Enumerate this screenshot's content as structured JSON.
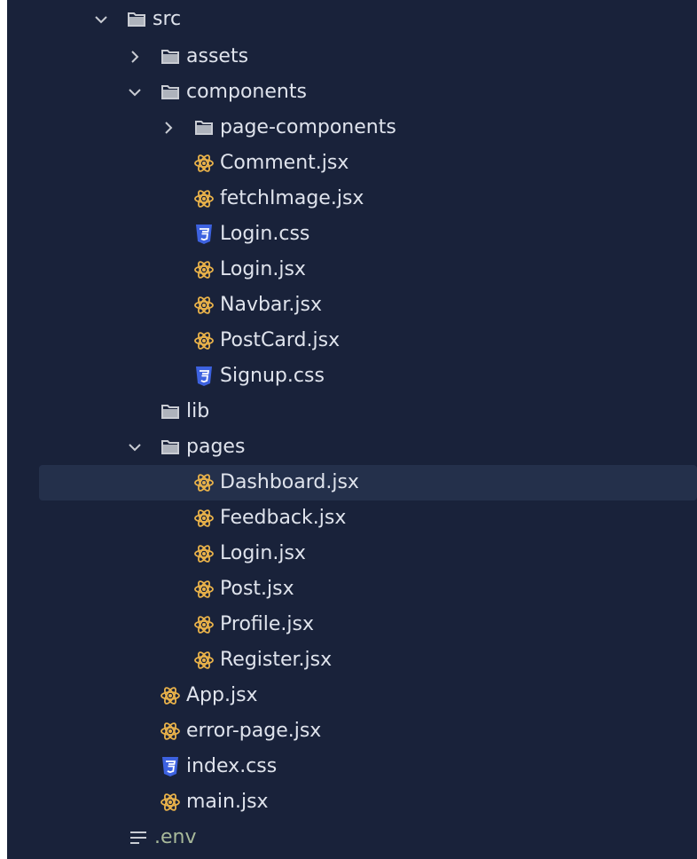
{
  "colors": {
    "panel_bg": "#19223a",
    "selected_bg": "#24304b",
    "text": "#dfe3ec",
    "react_icon": "#e9b24a",
    "css_icon": "#3d62e0",
    "folder_icon": "#c9ccd3",
    "env_text": "#a8b99a"
  },
  "tree": {
    "src": {
      "label": "src",
      "icon": "folder-icon",
      "state": "expanded"
    },
    "assets": {
      "label": "assets",
      "icon": "folder-icon",
      "state": "collapsed"
    },
    "components": {
      "label": "components",
      "icon": "folder-icon",
      "state": "expanded"
    },
    "page_components": {
      "label": "page-components",
      "icon": "folder-icon",
      "state": "collapsed"
    },
    "components_files": [
      {
        "label": "Comment.jsx",
        "icon": "react-icon"
      },
      {
        "label": "fetchImage.jsx",
        "icon": "react-icon"
      },
      {
        "label": "Login.css",
        "icon": "css-icon"
      },
      {
        "label": "Login.jsx",
        "icon": "react-icon"
      },
      {
        "label": "Navbar.jsx",
        "icon": "react-icon"
      },
      {
        "label": "PostCard.jsx",
        "icon": "react-icon"
      },
      {
        "label": "Signup.css",
        "icon": "css-icon"
      }
    ],
    "lib": {
      "label": "lib",
      "icon": "folder-icon"
    },
    "pages": {
      "label": "pages",
      "icon": "folder-icon",
      "state": "expanded"
    },
    "pages_files": [
      {
        "label": "Dashboard.jsx",
        "icon": "react-icon",
        "selected": true
      },
      {
        "label": "Feedback.jsx",
        "icon": "react-icon"
      },
      {
        "label": "Login.jsx",
        "icon": "react-icon"
      },
      {
        "label": "Post.jsx",
        "icon": "react-icon"
      },
      {
        "label": "Profile.jsx",
        "icon": "react-icon"
      },
      {
        "label": "Register.jsx",
        "icon": "react-icon"
      }
    ],
    "src_files": [
      {
        "label": "App.jsx",
        "icon": "react-icon"
      },
      {
        "label": "error-page.jsx",
        "icon": "react-icon"
      },
      {
        "label": "index.css",
        "icon": "css-icon"
      },
      {
        "label": "main.jsx",
        "icon": "react-icon"
      }
    ],
    "root_files": [
      {
        "label": ".env",
        "icon": "env-file-icon"
      }
    ]
  }
}
